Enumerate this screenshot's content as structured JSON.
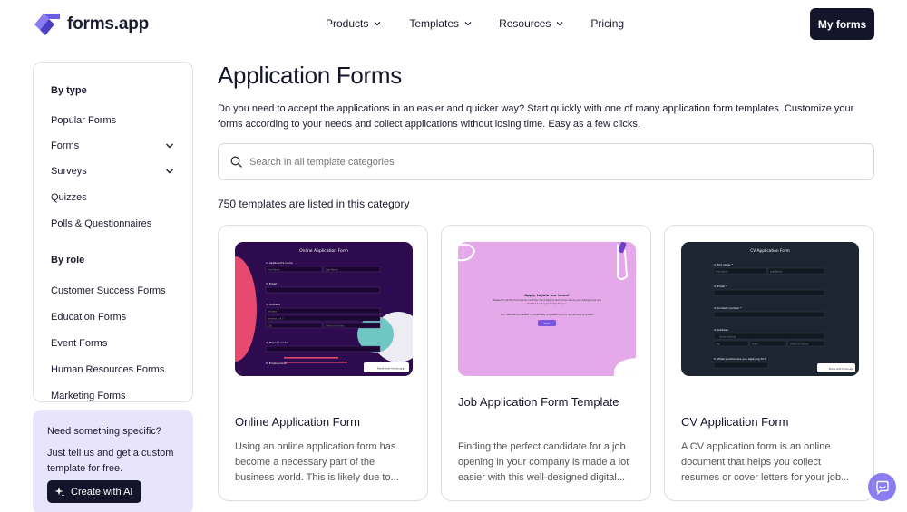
{
  "brand": {
    "name": "forms.app"
  },
  "nav": {
    "items": [
      {
        "label": "Products",
        "has_dropdown": true
      },
      {
        "label": "Templates",
        "has_dropdown": true
      },
      {
        "label": "Resources",
        "has_dropdown": true
      },
      {
        "label": "Pricing",
        "has_dropdown": false
      }
    ],
    "cta": "My forms"
  },
  "sidebar": {
    "by_type": "By type",
    "type_items": [
      "Popular Forms",
      "Forms",
      "Surveys",
      "Quizzes",
      "Polls & Questionnaires"
    ],
    "by_role": "By role",
    "role_items": [
      "Customer Success Forms",
      "Education Forms",
      "Event Forms",
      "Human Resources Forms",
      "Marketing Forms"
    ]
  },
  "help": {
    "title": "Need something specific?",
    "desc": "Just tell us and get a custom template for free.",
    "button": "Create with AI"
  },
  "main": {
    "title": "Application Forms",
    "description": "Do you need to accept the applications in an easier and quicker way? Start quickly with one of many application form templates. Customize your forms according to your needs and collect applications without losing time. Easy as a few clicks.",
    "search_placeholder": "Search in all template categories",
    "count_text": "750 templates are listed in this category"
  },
  "cards": [
    {
      "title": "Online Application Form",
      "desc": "Using an online application form has become a necessary part of the business world. This is likely due to...",
      "thumb": {
        "heading": "Online Application Form",
        "labels": [
          "1. Applicant's name",
          "2. Email",
          "3. Address",
          "4. Phone number",
          "5. Employment"
        ],
        "placeholders": [
          "First Name",
          "Last Name",
          "Address",
          "Address line 2",
          "City",
          "Select a country"
        ],
        "badge": "Made with forms.app"
      }
    },
    {
      "title": "Job Application Form Template",
      "desc": "Finding the perfect candidate for a job opening in your company is made a lot easier with this well-designed digital...",
      "thumb": {
        "heading": "Apply to join our team!",
        "text1": "Please fill out the form below carefully. This helps us learn more about your background and find the best opportunity for you.",
        "text2": "Your data will be treated confidentially and used only for recruitment purposes.",
        "button": "Start"
      }
    },
    {
      "title": "CV Application Form",
      "desc": "A CV application form is an online document that helps you collect resumes or cover letters for your job...",
      "thumb": {
        "heading": "CV Application Form",
        "labels": [
          "1. Full name *",
          "2. Email *",
          "3. Contact number *",
          "4. Address",
          "5. What position are you applying for?"
        ],
        "placeholders": [
          "First Name",
          "Last Name",
          "Street Address",
          "City",
          "State",
          "Select a country"
        ],
        "badge": "Made with forms.app"
      }
    }
  ],
  "colors": {
    "dark": "#14142b",
    "accent": "#8b7cf0",
    "help_bg": "#e8e4fb"
  }
}
